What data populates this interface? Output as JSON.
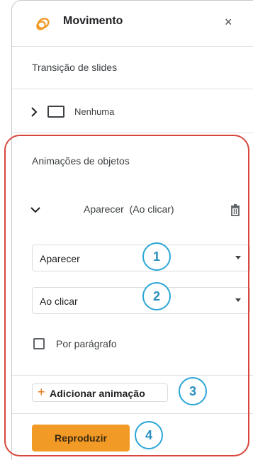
{
  "header": {
    "title": "Movimento",
    "close_symbol": "×"
  },
  "transition": {
    "section_title": "Transição de slides",
    "value": "Nenhuma"
  },
  "animations": {
    "section_title": "Animações de objetos",
    "current": "Aparecer  (Ao clicar)",
    "effect_dropdown": "Aparecer",
    "trigger_dropdown": "Ao clicar",
    "by_paragraph_label": "Por parágrafo",
    "add_button": "Adicionar animação",
    "add_button_plus": "+",
    "play_button": "Reproduzir"
  },
  "badges": [
    "1",
    "2",
    "3",
    "4"
  ],
  "colors": {
    "accent": "#f29a26",
    "outline": "#d9463b",
    "badge": "#2aa6d6"
  }
}
